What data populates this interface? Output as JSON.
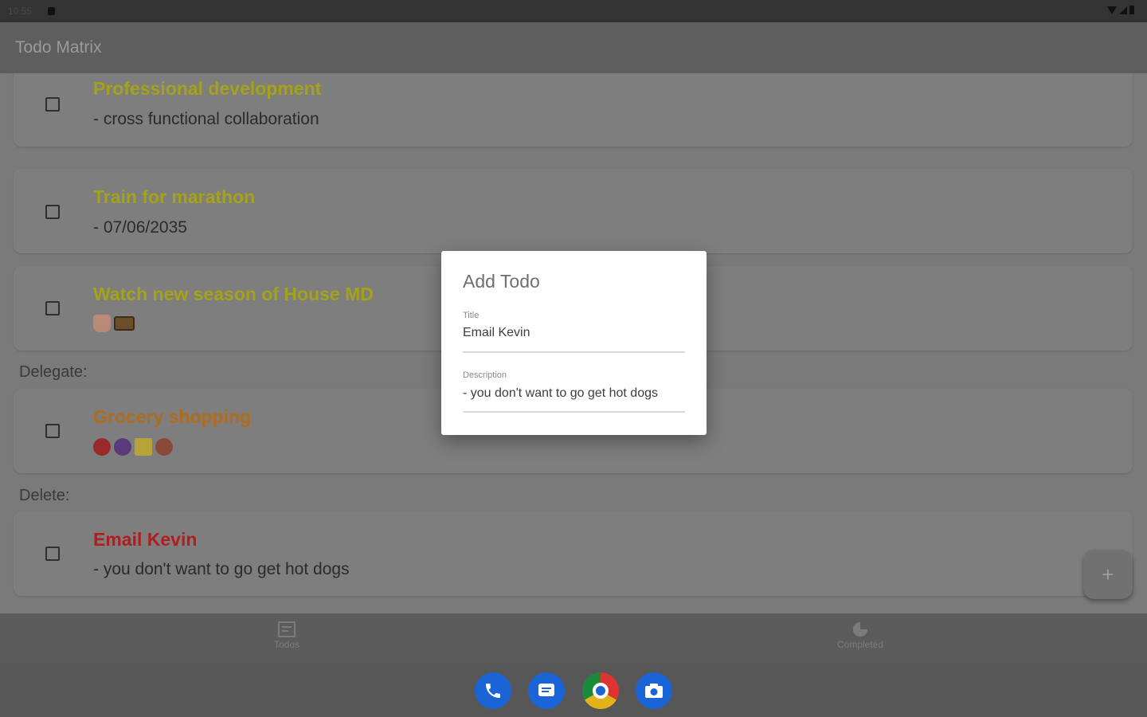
{
  "status_bar": {
    "time": "10:55"
  },
  "app_bar": {
    "title": "Todo Matrix"
  },
  "sections": {
    "delegate_label": "Delegate:",
    "delete_label": "Delete:"
  },
  "todos": [
    {
      "title": "Professional development",
      "description": "- cross functional collaboration",
      "color": "#a5a21a"
    },
    {
      "title": "Train for marathon",
      "description": "- 07/06/2035",
      "color": "#a5a21a"
    },
    {
      "title": "Watch new season of House MD",
      "description_icons": [
        "popcorn-icon",
        "film-icon"
      ],
      "color": "#a5a21a"
    },
    {
      "title": "Grocery shopping",
      "description_icons": [
        "strawberry-icon",
        "grapes-icon",
        "cheese-icon",
        "meat-icon"
      ],
      "color": "#b06c1e"
    },
    {
      "title": "Email Kevin",
      "description": "- you don't want to go get hot dogs",
      "color": "#b11d1d"
    }
  ],
  "dialog": {
    "title": "Add Todo",
    "title_field": {
      "label": "Title",
      "value": "Email Kevin"
    },
    "description_field": {
      "label": "Description",
      "value": "- you don't want to go get hot dogs"
    }
  },
  "fab": {
    "icon": "plus-icon",
    "label": "+"
  },
  "bottom_nav": [
    {
      "label": "Todos",
      "icon": "todo-list-icon"
    },
    {
      "label": "Completed",
      "icon": "pie-chart-icon"
    }
  ],
  "dock": [
    "phone-icon",
    "messages-icon",
    "chrome-icon",
    "camera-icon"
  ]
}
